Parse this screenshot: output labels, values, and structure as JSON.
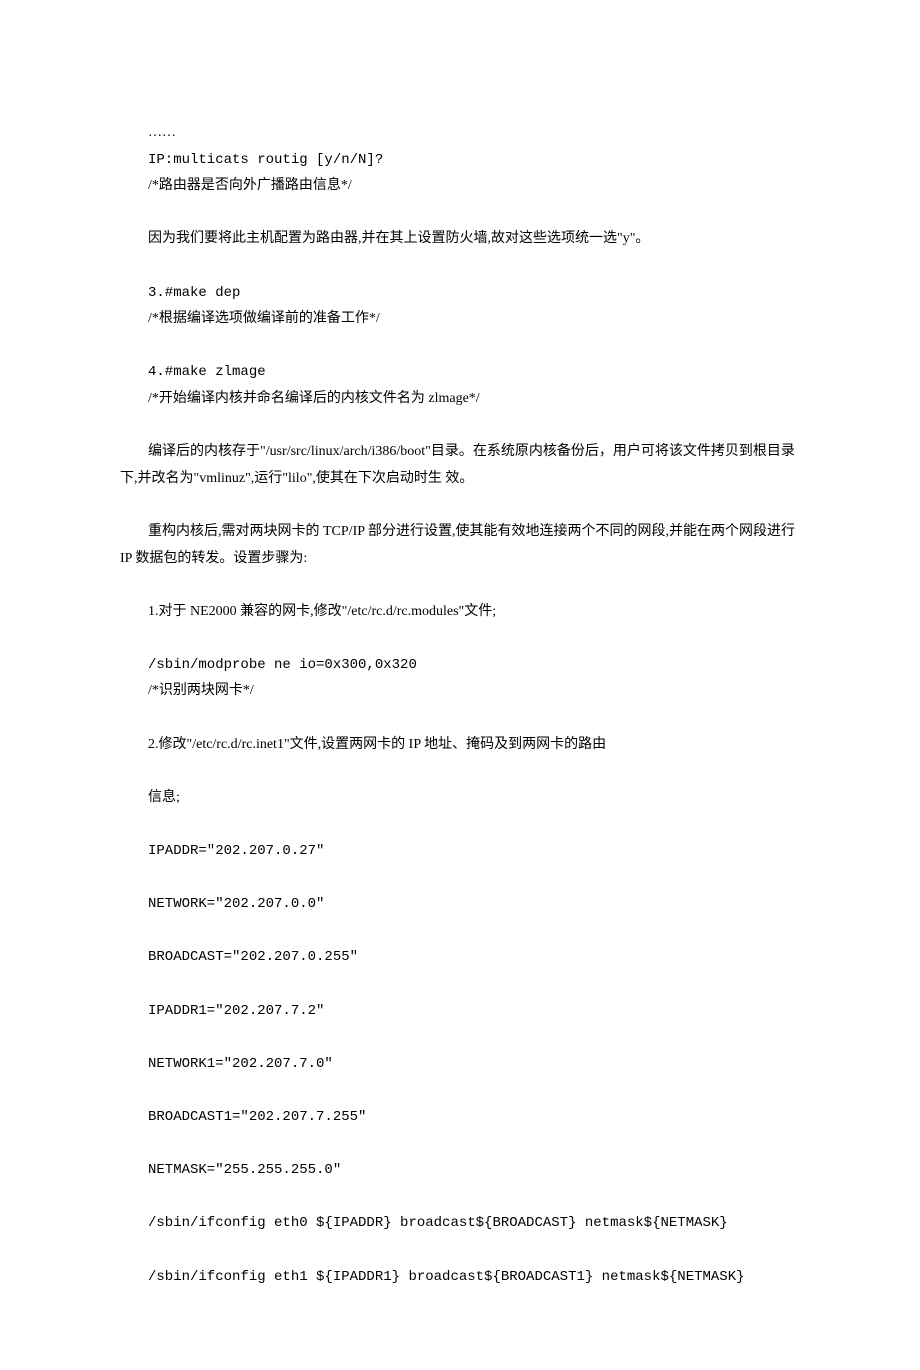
{
  "lines": {
    "l1": "……",
    "l2": "IP:multicats routig [y/n/N]?",
    "l3": "/*路由器是否向外广播路由信息*/",
    "l4": "因为我们要将此主机配置为路由器,并在其上设置防火墙,故对这些选项统一选\"y\"。",
    "l5": "3.#make dep",
    "l6": "/*根据编译选项做编译前的准备工作*/",
    "l7": "4.#make zlmage",
    "l8": "/*开始编译内核并命名编译后的内核文件名为 zlmage*/",
    "l9": "编译后的内核存于\"/usr/src/linux/arch/i386/boot\"目录。在系统原内核备份后，用户可将该文件拷贝到根目录下,并改名为\"vmlinuz\",运行\"lilo\",使其在下次启动时生 效。",
    "l10": "重构内核后,需对两块网卡的 TCP/IP 部分进行设置,使其能有效地连接两个不同的网段,并能在两个网段进行 IP 数据包的转发。设置步骤为:",
    "l11": "1.对于 NE2000 兼容的网卡,修改\"/etc/rc.d/rc.modules\"文件;",
    "l12": "/sbin/modprobe ne io=0x300,0x320",
    "l13": "/*识别两块网卡*/",
    "l14": "2.修改\"/etc/rc.d/rc.inet1\"文件,设置两网卡的 IP 地址、掩码及到两网卡的路由",
    "l15": "信息;",
    "l16": "IPADDR=\"202.207.0.27\"",
    "l17": "NETWORK=\"202.207.0.0\"",
    "l18": "BROADCAST=\"202.207.0.255\"",
    "l19": "IPADDR1=\"202.207.7.2\"",
    "l20": "NETWORK1=\"202.207.7.0\"",
    "l21": "BROADCAST1=\"202.207.7.255\"",
    "l22": "NETMASK=\"255.255.255.0\"",
    "l23": "/sbin/ifconfig eth0 ${IPADDR} broadcast${BROADCAST} netmask${NETMASK}",
    "l24": "/sbin/ifconfig eth1 ${IPADDR1} broadcast${BROADCAST1} netmask${NETMASK}"
  }
}
